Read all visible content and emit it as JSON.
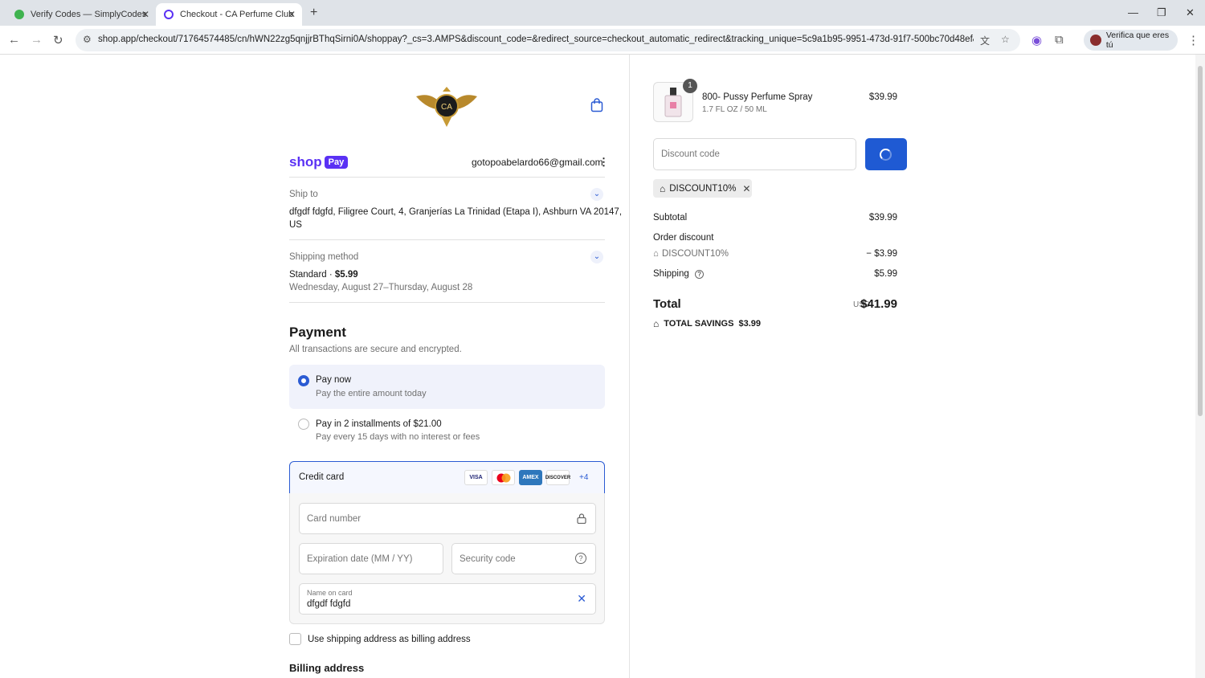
{
  "browser": {
    "tabs": [
      {
        "title": "Verify Codes — SimplyCodes",
        "active": false
      },
      {
        "title": "Checkout - CA Perfume Club",
        "active": true
      }
    ],
    "url": "shop.app/checkout/71764574485/cn/hWN22zg5qnjjrBThqSirni0A/shoppay?_cs=3.AMPS&discount_code=&redirect_source=checkout_automatic_redirect&tracking_unique=5c9a1b95-9951-473d-91f7-500bc70d48ef&tracking...",
    "profile_label": "Verifica que eres tú"
  },
  "header": {
    "logo_text": "CA",
    "shop_label": "shop",
    "pay_label": "Pay",
    "email": "gotopoabelardo66@gmail.com"
  },
  "ship_to": {
    "label": "Ship to",
    "address_line1": "dfgdf fdgfd, Filigree Court, 4, Granjerías La Trinidad (Etapa I), Ashburn VA 20147,",
    "address_line2": "US"
  },
  "shipping_method": {
    "label": "Shipping method",
    "name": "Standard · ",
    "price": "$5.99",
    "dates": "Wednesday, August 27–Thursday, August 28"
  },
  "payment": {
    "title": "Payment",
    "subtitle": "All transactions are secure and encrypted.",
    "options": [
      {
        "title": "Pay now",
        "subtitle": "Pay the entire amount today",
        "selected": true
      },
      {
        "title": "Pay in 2 installments of $21.00",
        "subtitle": "Pay every 15 days with no interest or fees",
        "selected": false
      }
    ],
    "method_label": "Credit card",
    "card_brands": [
      "VISA",
      "MC",
      "AMEX",
      "DISCOVER"
    ],
    "more_brands": "+4",
    "card_number_placeholder": "Card number",
    "expiration_placeholder": "Expiration date (MM / YY)",
    "security_placeholder": "Security code",
    "name_label": "Name on card",
    "name_value": "dfgdf fdgfd",
    "billing_checkbox_label": "Use shipping address as billing address",
    "billing_heading": "Billing address"
  },
  "summary": {
    "item": {
      "name": "800- Pussy Perfume Spray",
      "variant": "1.7 FL OZ / 50 ML",
      "price": "$39.99",
      "quantity": "1"
    },
    "discount_placeholder": "Discount code",
    "applied_code": "DISCOUNT10%",
    "subtotal_label": "Subtotal",
    "subtotal": "$39.99",
    "order_discount_label": "Order discount",
    "discount_code_line": "DISCOUNT10%",
    "discount_amount": "− $3.99",
    "shipping_label": "Shipping",
    "shipping": "$5.99",
    "total_label": "Total",
    "currency": "USD",
    "total": "$41.99",
    "savings_label": "TOTAL SAVINGS",
    "savings": "$3.99"
  },
  "colors": {
    "accent": "#2b5bd3",
    "shoppay": "#5a31f4",
    "button": "#1f5ad3"
  }
}
